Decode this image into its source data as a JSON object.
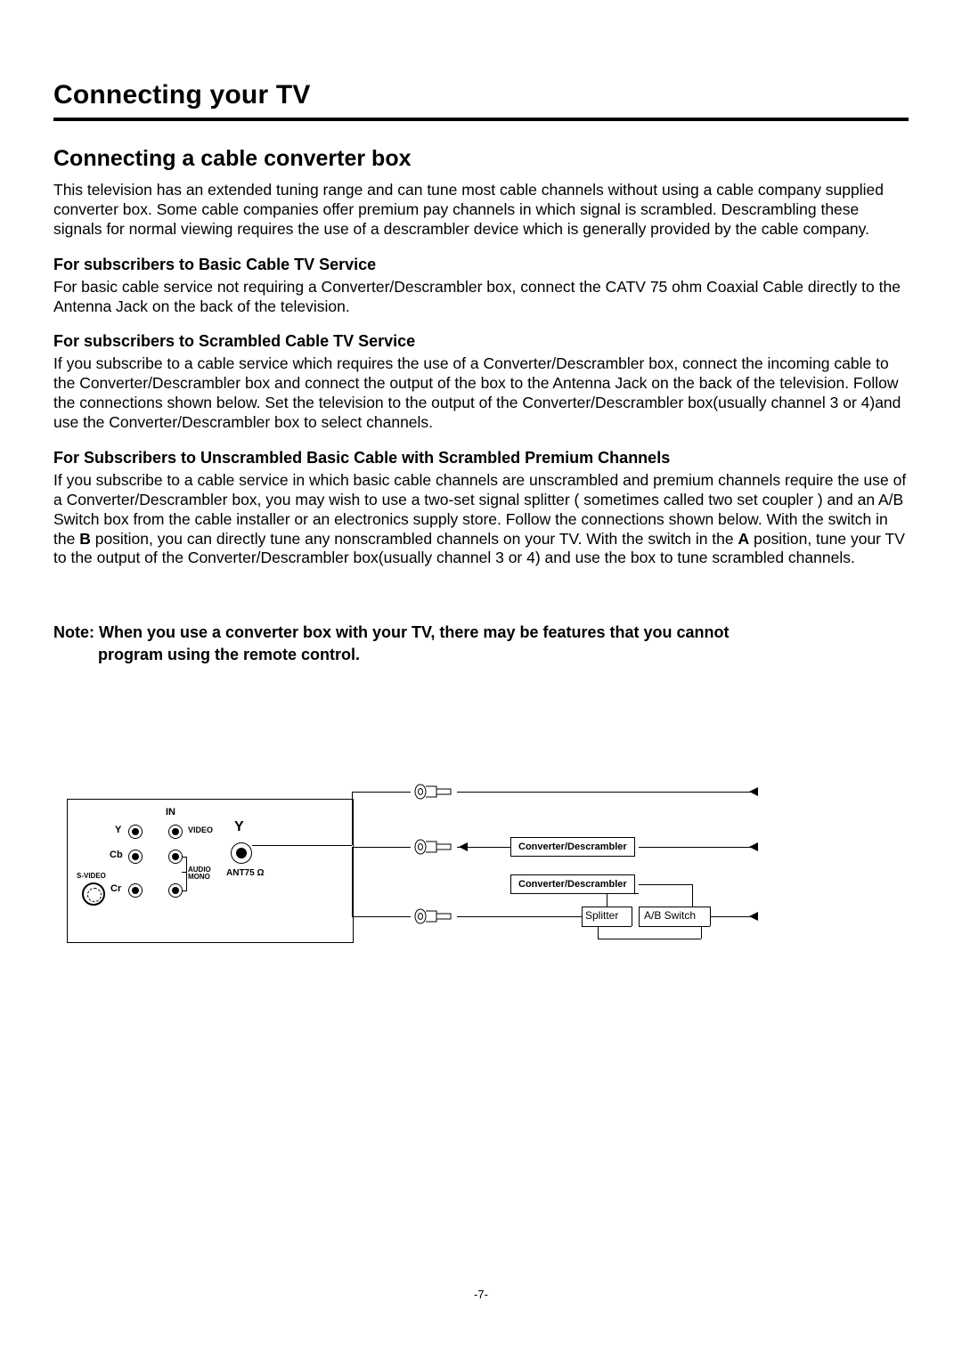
{
  "page": {
    "title": "Connecting your TV",
    "subtitle": "Connecting a cable converter box",
    "intro": "This television has an extended tuning range and can tune most cable channels without using a cable company supplied converter box. Some cable companies offer premium pay channels  in which signal is scrambled. Descrambling these signals for normal viewing requires the use of a descrambler device which is generally provided by the cable company.",
    "sections": [
      {
        "heading": "For subscribers to Basic Cable TV Service",
        "body": "For basic cable service not requiring a Converter/Descrambler box, connect the CATV 75 ohm Coaxial Cable directly to the Antenna Jack on the back of the television."
      },
      {
        "heading": "For subscribers to Scrambled Cable TV Service",
        "body": "If you subscribe to a cable service which requires the use of a Converter/Descrambler box, connect the incoming cable to the Converter/Descrambler box and connect the output of the box to the Antenna Jack on the back of the television. Follow the connections shown below. Set the television to the output of the Converter/Descrambler box(usually channel 3 or 4)and use the Converter/Descrambler box to select channels."
      },
      {
        "heading": "For Subscribers to Unscrambled Basic Cable with Scrambled Premium Channels",
        "body_pre": "If you subscribe to a cable service in which basic cable channels are unscrambled and premium channels require the use of a Converter/Descrambler box, you may wish to use a two-set signal splitter ( sometimes called   two set coupler ) and an A/B Switch box from the cable installer or an electronics supply store. Follow the connections shown below. With the switch in the ",
        "bold_b": "B",
        "body_mid": " position, you can directly tune any nonscrambled channels on your TV. With the switch in the ",
        "bold_a": "A",
        "body_post": " position, tune your TV to the output of the Converter/Descrambler box(usually channel 3 or 4) and use the box to tune scrambled channels."
      }
    ],
    "note_line1": "Note: When you use a converter box with your TV, there may be features that you cannot",
    "note_line2": "program using the remote control.",
    "page_number": "-7-"
  },
  "diagram": {
    "tv": {
      "in": "IN",
      "y": "Y",
      "cb": "Cb",
      "cr": "Cr",
      "video": "VIDEO",
      "audio": "AUDIO\nMONO",
      "svideo": "S-VIDEO",
      "ant": "ANT75 Ω"
    },
    "converter1": "Converter/Descrambler",
    "converter2": "Converter/Descrambler",
    "splitter": "Splitter",
    "abswitch": "A/B Switch"
  }
}
